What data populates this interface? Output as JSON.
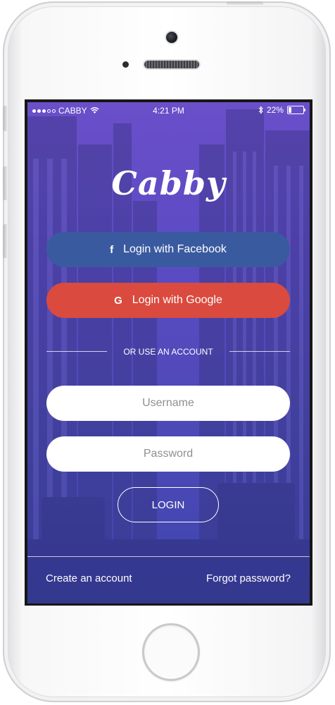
{
  "status_bar": {
    "carrier": "CABBY",
    "time": "4:21 PM",
    "battery": "22%",
    "battery_level": 0.22,
    "signal_dots_filled": 3,
    "signal_dots_total": 5
  },
  "app": {
    "logo": "Cabby",
    "brand_color": "#5a4bc2"
  },
  "social": {
    "facebook_label": "Login with Facebook",
    "facebook_icon": "facebook-icon",
    "facebook_color": "#3a5aa0",
    "google_label": "Login with Google",
    "google_icon": "google-icon",
    "google_color": "#da4a3e"
  },
  "divider": {
    "text": "OR USE AN ACCOUNT"
  },
  "form": {
    "username_placeholder": "Username",
    "password_placeholder": "Password",
    "login_label": "LOGIN"
  },
  "footer": {
    "create_account": "Create an account",
    "forgot_password": "Forgot password?"
  }
}
